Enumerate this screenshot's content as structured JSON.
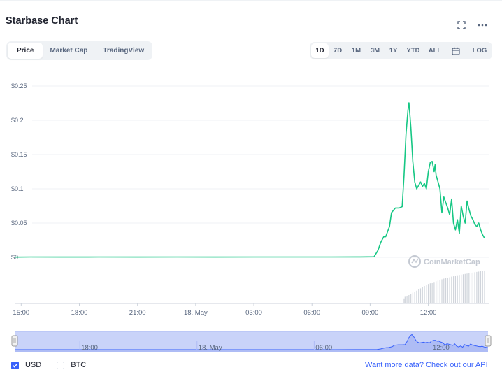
{
  "title": "Starbase Chart",
  "header_icons": {
    "fullscreen": "fullscreen-icon",
    "more": "more-horizontal-icon"
  },
  "tabs": [
    {
      "label": "Price",
      "active": true
    },
    {
      "label": "Market Cap",
      "active": false
    },
    {
      "label": "TradingView",
      "active": false
    }
  ],
  "ranges": [
    {
      "label": "1D",
      "active": true
    },
    {
      "label": "7D",
      "active": false
    },
    {
      "label": "1M",
      "active": false
    },
    {
      "label": "3M",
      "active": false
    },
    {
      "label": "1Y",
      "active": false
    },
    {
      "label": "YTD",
      "active": false
    },
    {
      "label": "ALL",
      "active": false
    }
  ],
  "calendar_icon": "calendar-icon",
  "log_label": "LOG",
  "watermark": "CoinMarketCap",
  "legend": [
    {
      "label": "USD",
      "checked": true
    },
    {
      "label": "BTC",
      "checked": false
    }
  ],
  "api": {
    "prefix": "Want more data?",
    "link": "Check out our API"
  },
  "colors": {
    "line": "#16c784",
    "accent": "#3861fb",
    "navigator_fill": "#c9d3f9"
  },
  "chart_data": {
    "type": "line",
    "title": "",
    "xlabel": "",
    "ylabel": "",
    "x_unit": "hours since 14:00 (16 May)",
    "x_range": [
      14.7,
      38.9
    ],
    "ylim": [
      0,
      0.25
    ],
    "yticks": [
      {
        "value": 0.25,
        "label": "$0.25"
      },
      {
        "value": 0.2,
        "label": "$0.2"
      },
      {
        "value": 0.15,
        "label": "$0.15"
      },
      {
        "value": 0.1,
        "label": "$0.1"
      },
      {
        "value": 0.05,
        "label": "$0.05"
      },
      {
        "value": 0,
        "label": "$0"
      }
    ],
    "xticks": [
      {
        "value": 15,
        "label": "15:00"
      },
      {
        "value": 18,
        "label": "18:00"
      },
      {
        "value": 21,
        "label": "21:00"
      },
      {
        "value": 24,
        "label": "18. May"
      },
      {
        "value": 27,
        "label": "03:00"
      },
      {
        "value": 30,
        "label": "06:00"
      },
      {
        "value": 33,
        "label": "09:00"
      },
      {
        "value": 36,
        "label": "12:00"
      }
    ],
    "grid": true,
    "series": [
      {
        "name": "",
        "x": [
          14.7,
          15.5,
          17.0,
          19.0,
          21.0,
          23.0,
          25.0,
          27.0,
          29.0,
          31.0,
          32.5,
          33.2,
          33.4,
          33.55,
          33.7,
          33.8,
          34.0,
          34.1,
          34.3,
          34.5,
          34.65,
          34.75,
          34.85,
          34.95,
          35.0,
          35.1,
          35.2,
          35.3,
          35.4,
          35.5,
          35.6,
          35.7,
          35.8,
          35.9,
          36.0,
          36.1,
          36.2,
          36.3,
          36.35,
          36.4,
          36.5,
          36.6,
          36.7,
          36.8,
          36.9,
          37.0,
          37.1,
          37.2,
          37.3,
          37.4,
          37.5,
          37.6,
          37.7,
          37.8,
          37.9,
          38.0,
          38.1,
          38.2,
          38.3,
          38.4,
          38.5,
          38.6,
          38.7,
          38.8,
          38.9
        ],
        "y": [
          0.0003,
          0.0005,
          0.0004,
          0.0005,
          0.0004,
          0.0005,
          0.0004,
          0.0005,
          0.0005,
          0.0005,
          0.0006,
          0.0008,
          0.01,
          0.022,
          0.03,
          0.03,
          0.045,
          0.065,
          0.072,
          0.072,
          0.074,
          0.12,
          0.18,
          0.215,
          0.2255,
          0.19,
          0.14,
          0.11,
          0.1,
          0.105,
          0.11,
          0.1035,
          0.108,
          0.1,
          0.125,
          0.1385,
          0.14,
          0.125,
          0.135,
          0.12,
          0.11,
          0.1,
          0.065,
          0.088,
          0.08,
          0.072,
          0.062,
          0.085,
          0.05,
          0.04,
          0.055,
          0.035,
          0.075,
          0.06,
          0.05,
          0.082,
          0.07,
          0.06,
          0.055,
          0.048,
          0.045,
          0.05,
          0.04,
          0.033,
          0.028
        ]
      }
    ],
    "volume": {
      "x": [
        34.75,
        34.8,
        34.9,
        35.0,
        35.1,
        35.2,
        35.3,
        35.4,
        35.5,
        35.6,
        35.7,
        35.8,
        35.9,
        36.0,
        36.1,
        36.2,
        36.3,
        36.4,
        36.5,
        36.6,
        36.7,
        36.8,
        36.9,
        37.0,
        37.1,
        37.2,
        37.3,
        37.4,
        37.5,
        37.6,
        37.7,
        37.8,
        37.9,
        38.0,
        38.1,
        38.2,
        38.3,
        38.4,
        38.5,
        38.6,
        38.7,
        38.8,
        38.9
      ],
      "relative": [
        0.15,
        0.2,
        0.22,
        0.25,
        0.28,
        0.32,
        0.35,
        0.38,
        0.42,
        0.45,
        0.48,
        0.52,
        0.55,
        0.58,
        0.6,
        0.62,
        0.64,
        0.66,
        0.68,
        0.7,
        0.72,
        0.74,
        0.75,
        0.77,
        0.78,
        0.8,
        0.81,
        0.82,
        0.84,
        0.85,
        0.86,
        0.87,
        0.88,
        0.89,
        0.9,
        0.91,
        0.92,
        0.93,
        0.94,
        0.95,
        0.96,
        0.97,
        0.98
      ]
    },
    "navigator": {
      "xticks": [
        {
          "value": 18,
          "label": "18:00"
        },
        {
          "value": 24,
          "label": "18. May"
        },
        {
          "value": 30,
          "label": "06:00"
        },
        {
          "value": 36,
          "label": "12:00"
        }
      ]
    }
  }
}
